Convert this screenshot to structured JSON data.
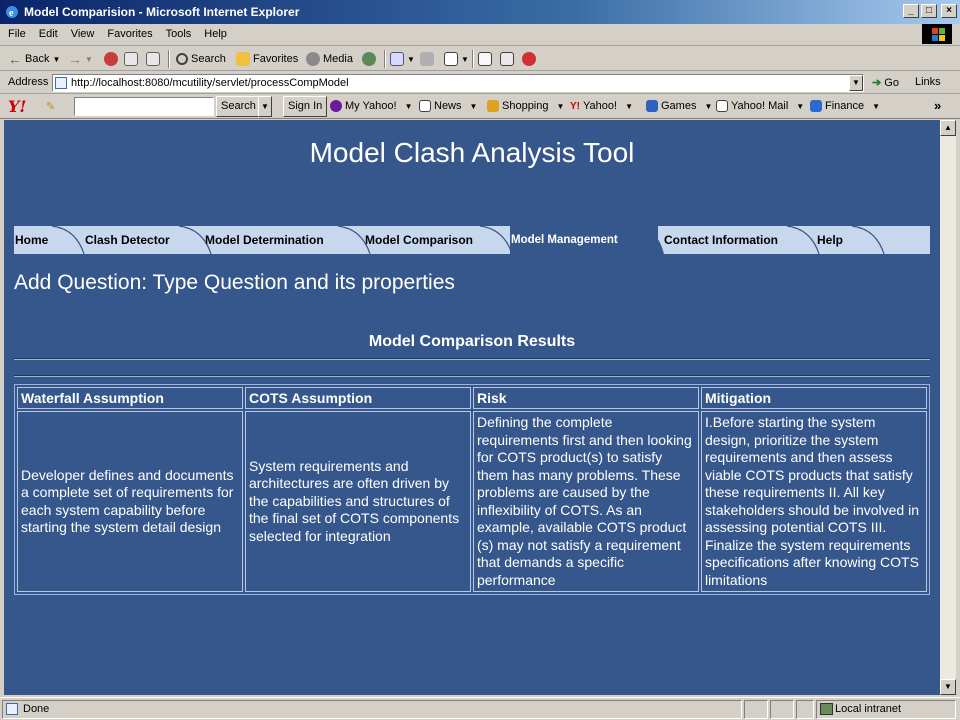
{
  "window": {
    "title": "Model Comparision - Microsoft Internet Explorer",
    "controls": [
      "_",
      "□",
      "×"
    ]
  },
  "menu": [
    "File",
    "Edit",
    "View",
    "Favorites",
    "Tools",
    "Help"
  ],
  "toolbar": {
    "back": "Back",
    "search": "Search",
    "favorites": "Favorites",
    "media": "Media"
  },
  "address": {
    "label": "Address",
    "url": "http://localhost:8080/mcutility/servlet/processCompModel",
    "go": "Go",
    "links": "Links"
  },
  "yahoo": {
    "logo": "Y!",
    "search_button": "Search",
    "sign_in": "Sign In",
    "items": [
      "My Yahoo!",
      "News",
      "Shopping",
      "Yahoo!",
      "Games",
      "Yahoo! Mail",
      "Finance"
    ],
    "more": "»"
  },
  "page": {
    "title": "Model Clash Analysis Tool",
    "tabs": [
      "Home",
      "Clash Detector",
      "Model Determination",
      "Model Comparison",
      "Model Management",
      "Contact Information",
      "Help"
    ],
    "active_tab": "Model Management",
    "heading": "Add Question: Type Question and its properties",
    "results_title": "Model Comparison Results",
    "table": {
      "headers": [
        "Waterfall Assumption",
        "COTS Assumption",
        "Risk",
        "Mitigation"
      ],
      "row": [
        "Developer defines and documents a complete set of requirements for each system capability before starting the system detail design",
        "System requirements and architectures are often driven by the capabilities and structures of the final set of COTS components selected for integration",
        "Defining the complete requirements first and then looking for COTS product(s) to satisfy them has many problems. These problems are caused by the inflexibility of COTS. As an example, available COTS product (s) may not satisfy a requirement that demands a specific performance",
        "I.Before starting the system design, prioritize the system requirements and then assess viable COTS products that satisfy these requirements II. All key stakeholders should be involved in assessing potential COTS III. Finalize the system requirements specifications after knowing COTS limitations"
      ]
    }
  },
  "status": {
    "text": "Done",
    "zone": "Local intranet"
  },
  "colors": {
    "page_bg": "#36578b",
    "tab_bar": "#c7d7ee",
    "titlebar": "#0a246a"
  }
}
